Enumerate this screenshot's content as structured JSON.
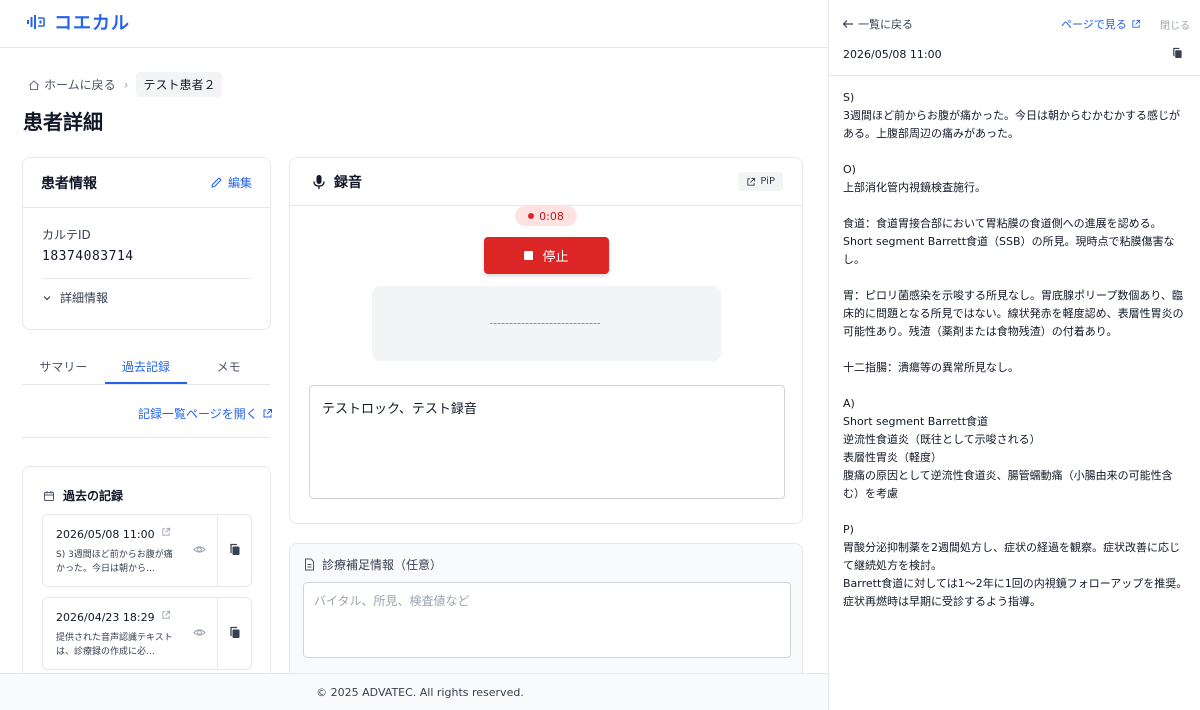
{
  "app": {
    "name": "コエカル",
    "brand_color": "#2563eb"
  },
  "breadcrumb": {
    "home": "ホームに戻る",
    "current": "テスト患者２"
  },
  "page_title": "患者詳細",
  "patient_card": {
    "title": "患者情報",
    "edit_label": "編集",
    "chart_id_label": "カルテID",
    "chart_id_value": "18374083714",
    "details_label": "詳細情報"
  },
  "tabs": [
    {
      "label": "サマリー"
    },
    {
      "label": "過去記録"
    },
    {
      "label": "メモ"
    }
  ],
  "active_tab": "過去記録",
  "open_list_link": "記録一覧ページを開く",
  "history": {
    "title": "過去の記録",
    "records": [
      {
        "date": "2026/05/08 11:00",
        "snippet": "S) 3週間ほど前からお腹が痛かった。今日は朝から…"
      },
      {
        "date": "2026/04/23 18:29",
        "snippet": "提供された音声認識テキストは、診療録の作成に必…"
      }
    ]
  },
  "recording": {
    "title": "録音",
    "pip_label": "PiP",
    "timer": "0:08",
    "stop_label": "停止",
    "transcript": "テストロック、テスト録音",
    "accent_color": "#dc2626"
  },
  "supplement": {
    "title": "診療補足情報（任意）",
    "placeholder": "バイタル、所見、検査値など"
  },
  "footer": "© 2025 ADVATEC. All rights reserved.",
  "drawer": {
    "back_label": "一覧に戻る",
    "page_link": "ページで見る",
    "close_label": "閉じる",
    "date": "2026/05/08 11:00",
    "lines": [
      "S)",
      "3週間ほど前からお腹が痛かった。今日は朝からむかむかする感じがある。上腹部周辺の痛みがあった。",
      "",
      "O)",
      "上部消化管内視鏡検査施行。",
      "",
      "食道：食道胃接合部において胃粘膜の食道側への進展を認める。Short segment Barrett食道（SSB）の所見。現時点で粘膜傷害なし。",
      "",
      "胃：ピロリ菌感染を示唆する所見なし。胃底腺ポリープ数個あり、臨床的に問題となる所見ではない。線状発赤を軽度認め、表層性胃炎の可能性あり。残渣（薬剤または食物残渣）の付着あり。",
      "",
      "十二指腸：潰瘍等の異常所見なし。",
      "",
      "A)",
      "Short segment Barrett食道",
      "逆流性食道炎（既往として示唆される）",
      "表層性胃炎（軽度）",
      "腹痛の原因として逆流性食道炎、腸管蠕動痛（小腸由来の可能性含む）を考慮",
      "",
      "P)",
      "胃酸分泌抑制薬を2週間処方し、症状の経過を観察。症状改善に応じて継続処方を検討。",
      "Barrett食道に対しては1〜2年に1回の内視鏡フォローアップを推奨。",
      "症状再燃時は早期に受診するよう指導。"
    ]
  }
}
